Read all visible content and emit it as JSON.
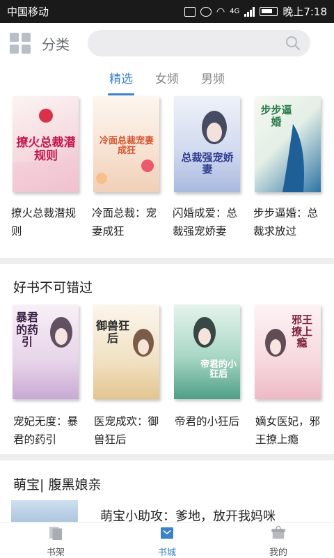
{
  "status": {
    "carrier": "中国移动",
    "time": "晚上7:18",
    "signal": "4G"
  },
  "header": {
    "category_label": "分类",
    "search_placeholder": ""
  },
  "tabs": [
    {
      "label": "精选",
      "active": true
    },
    {
      "label": "女频",
      "active": false
    },
    {
      "label": "男频",
      "active": false
    }
  ],
  "featured": [
    {
      "title": "撩火总裁潜规则",
      "cover_text": "撩火总裁潜规则",
      "colors": [
        "#f7eef0",
        "#f2c8d4"
      ]
    },
    {
      "title": "冷面总裁：宠妻成狂",
      "cover_text": "冷面总裁宠妻成狂",
      "colors": [
        "#fbf0e8",
        "#f0d2bf"
      ]
    },
    {
      "title": "闪婚成爱：总裁强宠娇妻",
      "cover_text": "总裁强宠娇妻",
      "colors": [
        "#e9eef8",
        "#b8c7e8"
      ]
    },
    {
      "title": "步步逼婚：总裁求放过",
      "cover_text": "步步逼婚",
      "colors": [
        "#f2f6ef",
        "#2d6f9e"
      ]
    }
  ],
  "section2": {
    "title": "好书不可错过",
    "books": [
      {
        "title": "宠妃无度：暴君的药引",
        "cover_text": "暴君的药引",
        "colors": [
          "#f4ecf3",
          "#cdb0d6"
        ]
      },
      {
        "title": "医宠成欢：御兽狂后",
        "cover_text": "御兽狂后",
        "colors": [
          "#f6f1e6",
          "#e7cfa4"
        ]
      },
      {
        "title": "帝君的小狂后",
        "cover_text": "帝君的小狂后",
        "colors": [
          "#dcefe8",
          "#6ab39d"
        ]
      },
      {
        "title": "嫡女医妃，邪王撩上瘾",
        "cover_text": "邪王撩上瘾",
        "colors": [
          "#f9eef0",
          "#f1c3cd"
        ]
      }
    ]
  },
  "section3": {
    "title": "萌宝| 腹黑娘亲",
    "item_title": "萌宝小助攻：爹地，放开我妈咪"
  },
  "bottom_nav": [
    {
      "label": "书架",
      "active": false
    },
    {
      "label": "书城",
      "active": true
    },
    {
      "label": "我的",
      "active": false
    }
  ],
  "colors": {
    "accent": "#3a82c9",
    "statusbar": "#1a1a1a",
    "divider": "#eeeeee"
  }
}
